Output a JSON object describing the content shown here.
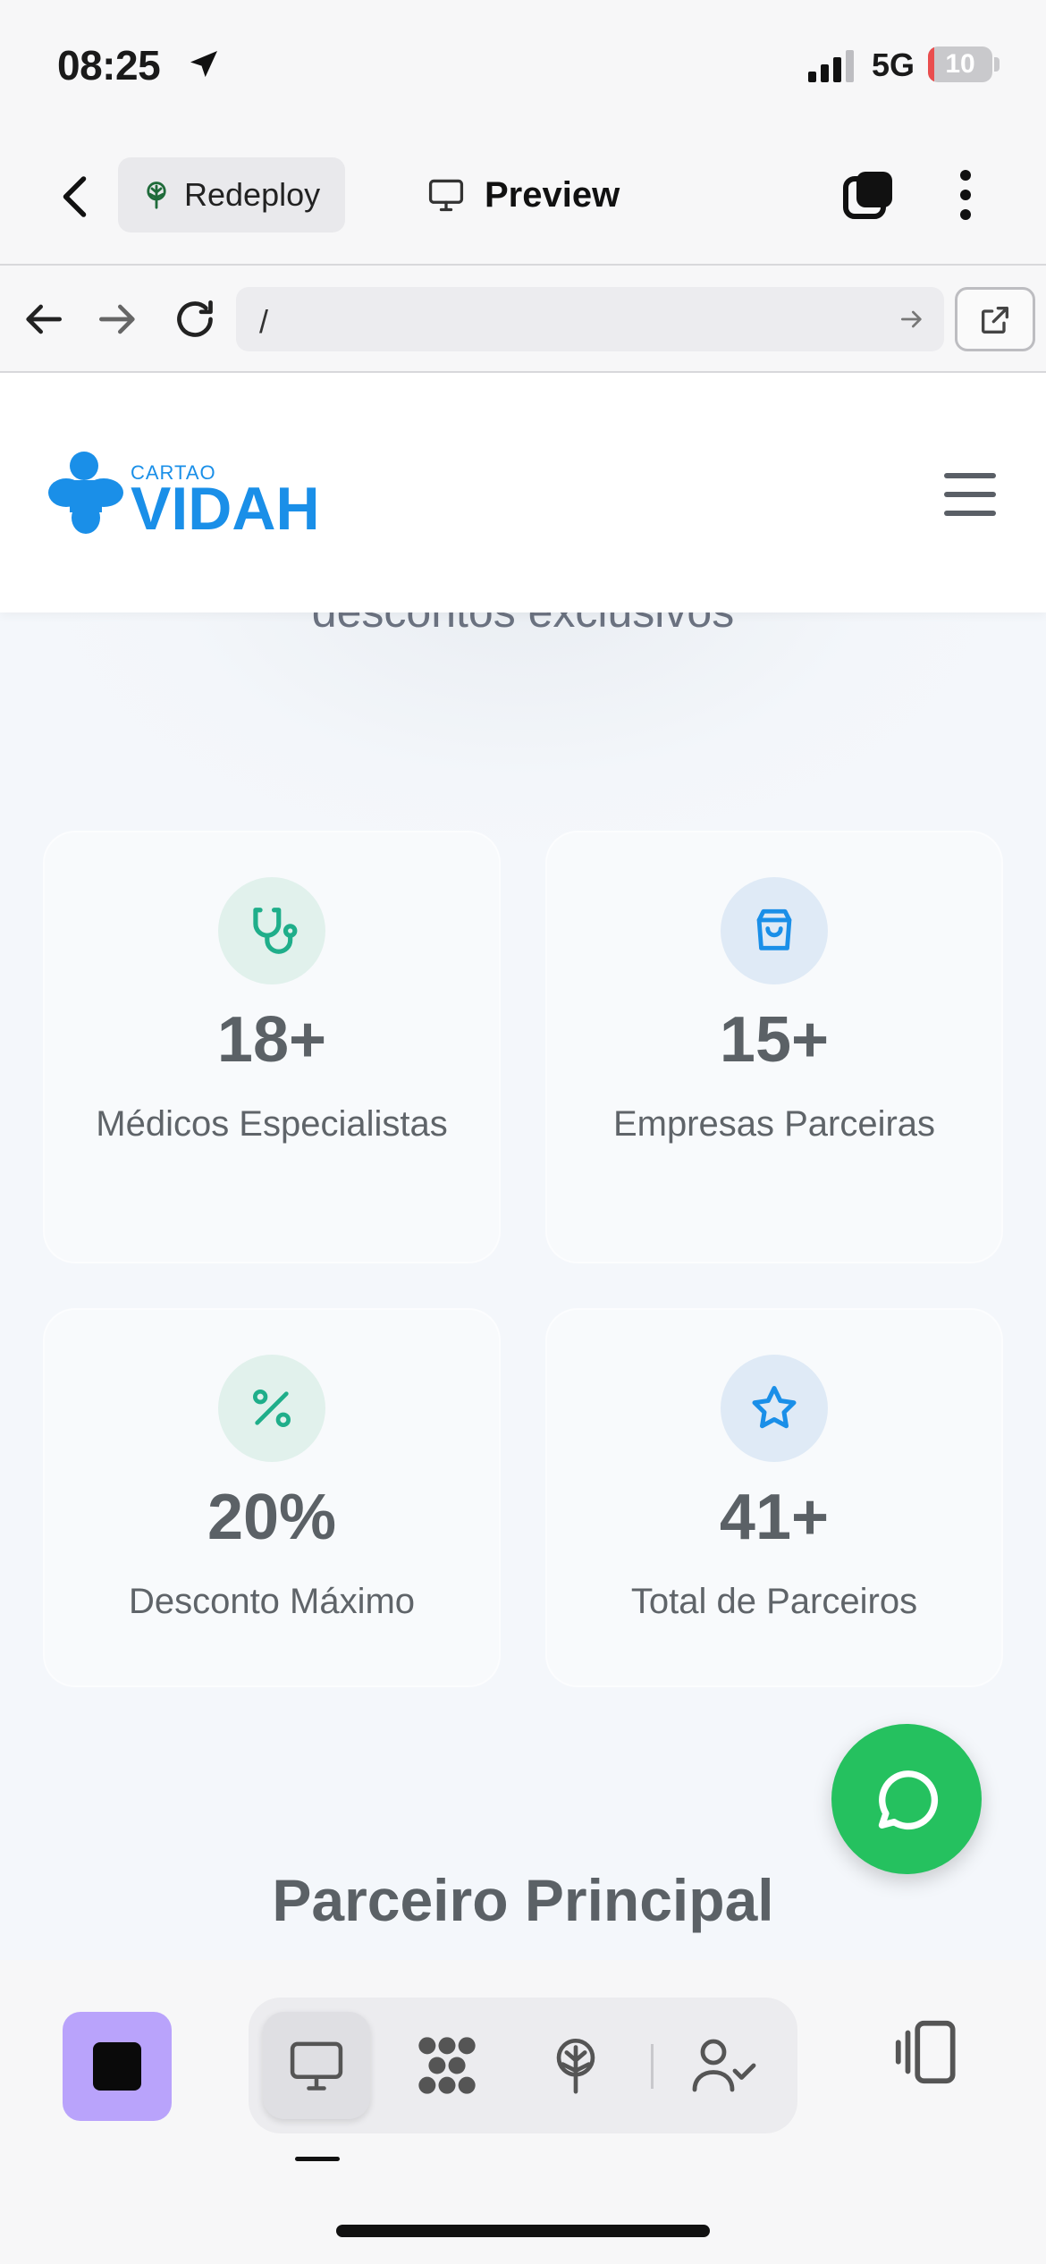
{
  "status_bar": {
    "time": "08:25",
    "network": "5G",
    "battery": "10",
    "battery_level": 0.1
  },
  "app_toolbar": {
    "redeploy_label": "Redeploy",
    "preview_label": "Preview"
  },
  "browser": {
    "url": "/"
  },
  "site": {
    "logo_top": "CARTAO",
    "logo_main": "VIDAH",
    "hero_partial": "descontos exclusivos",
    "stats": [
      {
        "value": "18+",
        "label": "Médicos Especialistas",
        "icon": "stethoscope-icon"
      },
      {
        "value": "15+",
        "label": "Empresas Parceiras",
        "icon": "shopping-bag-icon"
      },
      {
        "value": "20%",
        "label": "Desconto Máximo",
        "icon": "percent-icon"
      },
      {
        "value": "41+",
        "label": "Total de Parceiros",
        "icon": "star-icon"
      }
    ],
    "section_title": "Parceiro Principal"
  },
  "colors": {
    "brand_blue": "#1a8fe8",
    "whatsapp_green": "#25c15f",
    "accent_purple": "#b9a3fb",
    "teal": "#1fae8a"
  }
}
